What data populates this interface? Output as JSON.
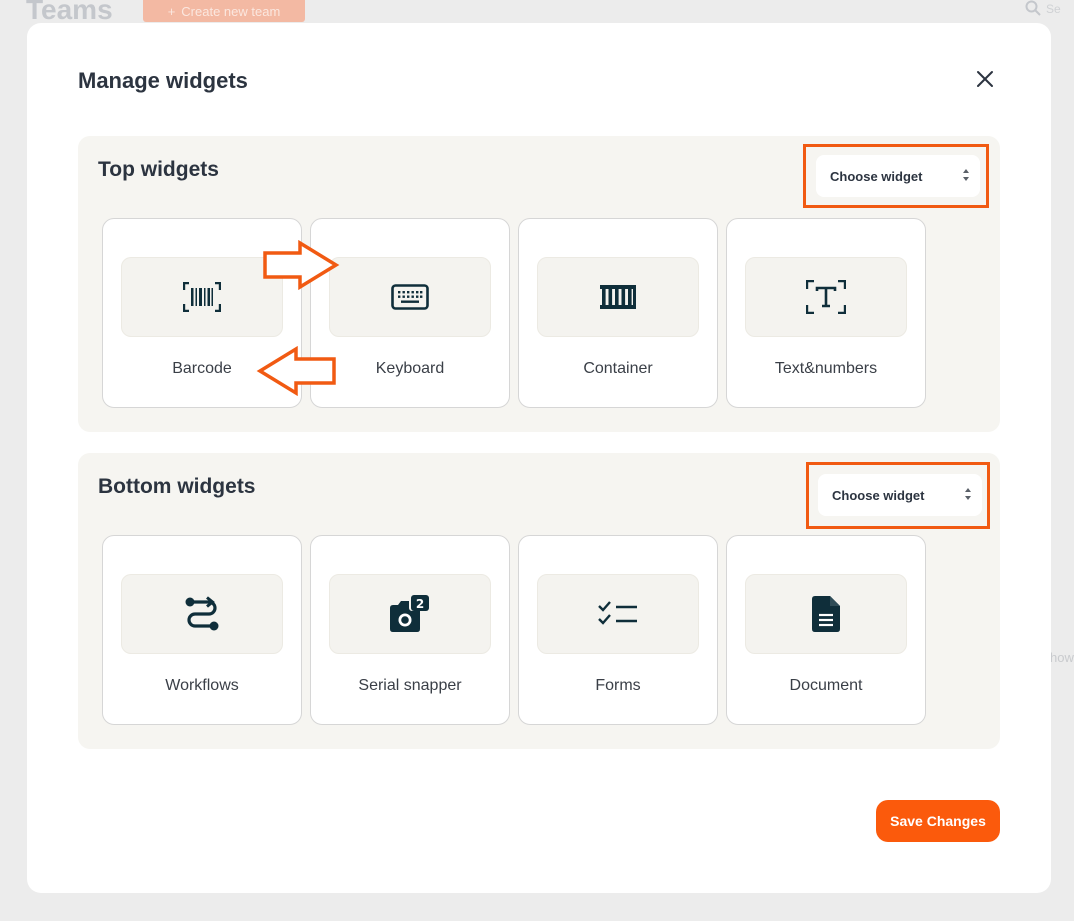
{
  "background": {
    "title": "Teams",
    "create_button": "Create new team",
    "search_text": "Se",
    "side_text": "how"
  },
  "modal": {
    "title": "Manage widgets",
    "close_icon": "close-icon"
  },
  "top_widgets": {
    "title": "Top widgets",
    "chooser_label": "Choose widget",
    "items": [
      {
        "label": "Barcode",
        "icon": "barcode-icon"
      },
      {
        "label": "Keyboard",
        "icon": "keyboard-icon"
      },
      {
        "label": "Container",
        "icon": "container-icon"
      },
      {
        "label": "Text&numbers",
        "icon": "text-scan-icon"
      }
    ]
  },
  "bottom_widgets": {
    "title": "Bottom widgets",
    "chooser_label": "Choose widget",
    "items": [
      {
        "label": "Workflows",
        "icon": "workflow-icon"
      },
      {
        "label": "Serial snapper",
        "icon": "camera-counter-icon",
        "badge": "2"
      },
      {
        "label": "Forms",
        "icon": "checklist-icon"
      },
      {
        "label": "Document",
        "icon": "document-icon"
      }
    ]
  },
  "footer": {
    "save_label": "Save Changes"
  },
  "colors": {
    "accent": "#fb5a0c",
    "annotation": "#f15a12",
    "icon": "#0f2e3a",
    "panel_bg": "#f6f5f1"
  }
}
